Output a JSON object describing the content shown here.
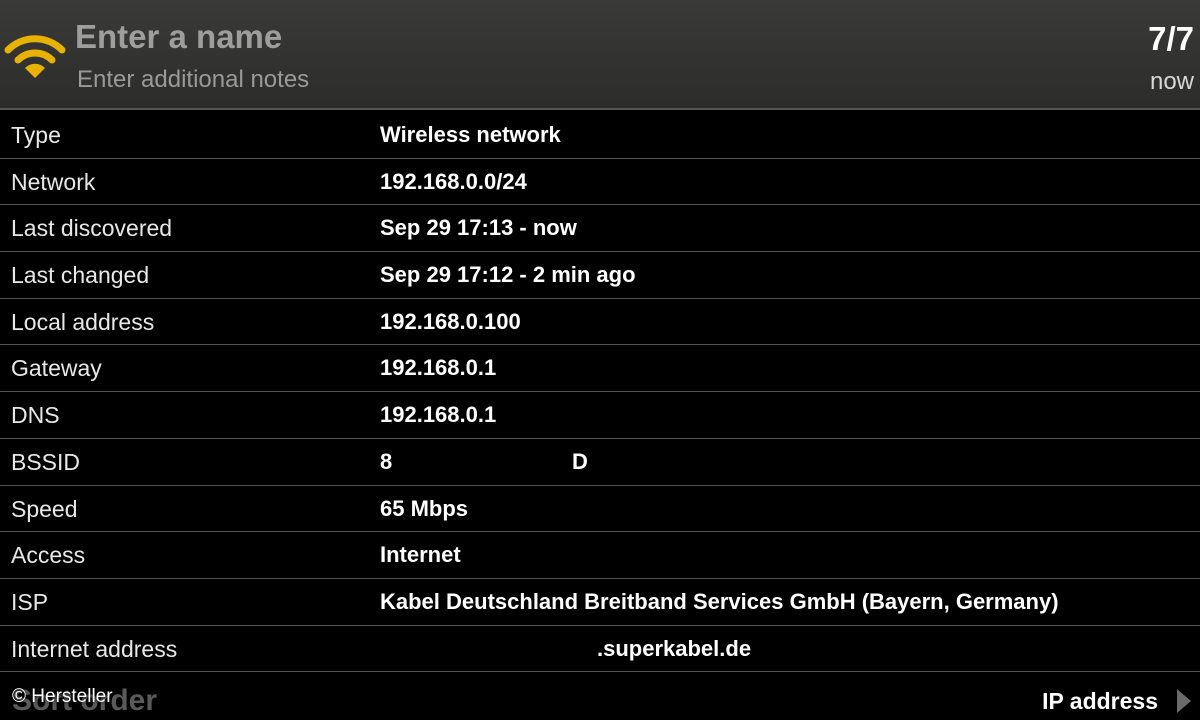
{
  "header": {
    "name_placeholder": "Enter a name",
    "notes_placeholder": "Enter additional notes",
    "count": "7/7",
    "time": "now",
    "icon": "wifi-icon"
  },
  "colors": {
    "wifi": "#e8b200",
    "header_bg": "#333331"
  },
  "rows": [
    {
      "label": "Type",
      "value": "Wireless network"
    },
    {
      "label": "Network",
      "value": "192.168.0.0/24"
    },
    {
      "label": "Last discovered",
      "value": "Sep 29 17:13 - now"
    },
    {
      "label": "Last changed",
      "value": "Sep 29 17:12 - 2 min ago"
    },
    {
      "label": "Local address",
      "value": "192.168.0.100"
    },
    {
      "label": "Gateway",
      "value": "192.168.0.1"
    },
    {
      "label": "DNS",
      "value": "192.168.0.1"
    },
    {
      "label": "BSSID",
      "value_start": "8",
      "value_end": "D"
    },
    {
      "label": "Speed",
      "value": "65 Mbps"
    },
    {
      "label": "Access",
      "value": "Internet"
    },
    {
      "label": "ISP",
      "value": "Kabel Deutschland Breitband Services GmbH (Bayern, Germany)"
    },
    {
      "label": "Internet address",
      "value": ".superkabel.de"
    }
  ],
  "footer": {
    "sort_label": "Sort order",
    "credit": "© Hersteller",
    "sort_value": "IP address",
    "icon": "chevron-right-icon"
  }
}
